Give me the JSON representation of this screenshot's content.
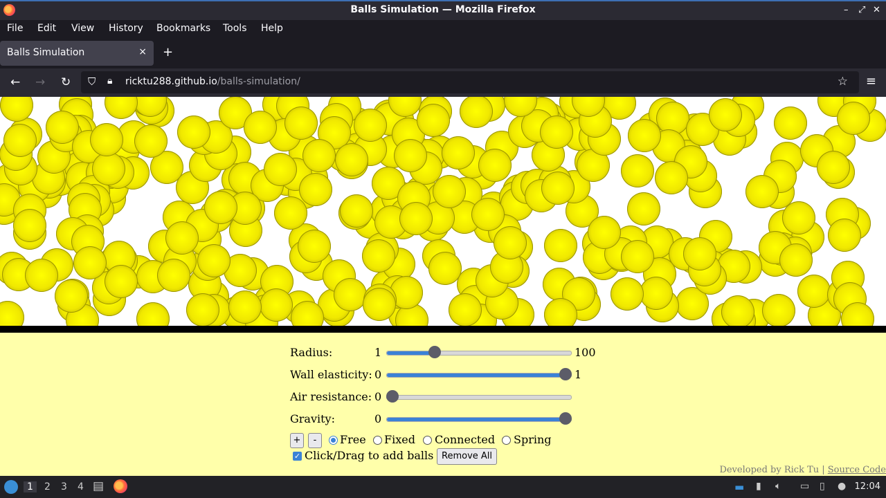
{
  "window": {
    "title": "Balls Simulation — Mozilla Firefox",
    "min": "–",
    "max": "⤢",
    "close": "✕"
  },
  "menu": [
    "File",
    "Edit",
    "View",
    "History",
    "Bookmarks",
    "Tools",
    "Help"
  ],
  "tab": {
    "label": "Balls Simulation",
    "close": "×",
    "new": "+"
  },
  "nav": {
    "back": "←",
    "forward": "→",
    "reload": "↻",
    "url_host": "ricktu288.github.io",
    "url_path": "/balls-simulation/",
    "star": "☆",
    "menu": "≡"
  },
  "controls": {
    "radius": {
      "label": "Radius:",
      "min": "1",
      "max": "100",
      "value_fraction": 0.26
    },
    "wall_elasticity": {
      "label": "Wall elasticity:",
      "min": "0",
      "max": "1",
      "value_fraction": 0.97
    },
    "air_resistance": {
      "label": "Air resistance:",
      "min": "0",
      "value_fraction": 0.03
    },
    "gravity": {
      "label": "Gravity:",
      "min": "0",
      "value_fraction": 0.97
    },
    "add_label": "+",
    "remove_label": "-",
    "modes": [
      {
        "label": "Free",
        "selected": true
      },
      {
        "label": "Fixed",
        "selected": false
      },
      {
        "label": "Connected",
        "selected": false
      },
      {
        "label": "Spring",
        "selected": false
      }
    ],
    "click_drag_label": "Click/Drag to add balls",
    "click_drag_checked": true,
    "remove_all_label": "Remove All"
  },
  "footer": {
    "text": "Developed by Rick Tu | ",
    "link": "Source Code"
  },
  "taskbar": {
    "workspaces": [
      "1",
      "2",
      "3",
      "4"
    ],
    "active_workspace": "1",
    "clock": "12:04"
  },
  "colors": {
    "ball": "#f0e800",
    "panel": "#ffffaa",
    "accent": "#3b82d6"
  }
}
